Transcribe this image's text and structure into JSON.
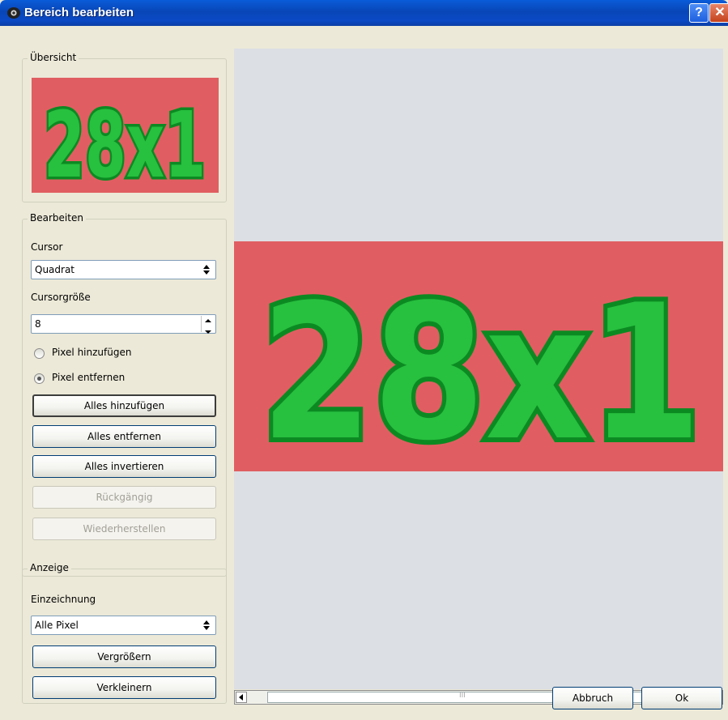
{
  "window": {
    "title": "Bereich bearbeiten",
    "help_label": "?",
    "close_label": "✕"
  },
  "overview": {
    "legend": "Übersicht"
  },
  "preview_text": "28x1",
  "edit": {
    "legend": "Bearbeiten",
    "cursor_label": "Cursor",
    "cursor_value": "Quadrat",
    "cursor_size_label": "Cursorgröße",
    "cursor_size_value": "8",
    "radio_add_label": "Pixel hinzufügen",
    "radio_remove_label": "Pixel entfernen",
    "selected_radio": "remove",
    "btn_add_all": "Alles hinzufügen",
    "btn_remove_all": "Alles entfernen",
    "btn_invert_all": "Alles invertieren",
    "btn_undo": "Rückgängig",
    "btn_redo": "Wiederherstellen"
  },
  "display": {
    "legend": "Anzeige",
    "drawing_label": "Einzeichnung",
    "drawing_value": "Alle Pixel",
    "btn_zoom_in": "Vergrößern",
    "btn_zoom_out": "Verkleinern"
  },
  "footer": {
    "cancel": "Abbruch",
    "ok": "Ok"
  },
  "colors": {
    "title_bar": "#0a5cd8",
    "mask_red": "#e8676a",
    "mask_green": "#1fb33a",
    "canvas_bg": "#dcdfe4"
  },
  "scrollbar": {
    "grip": "III"
  }
}
